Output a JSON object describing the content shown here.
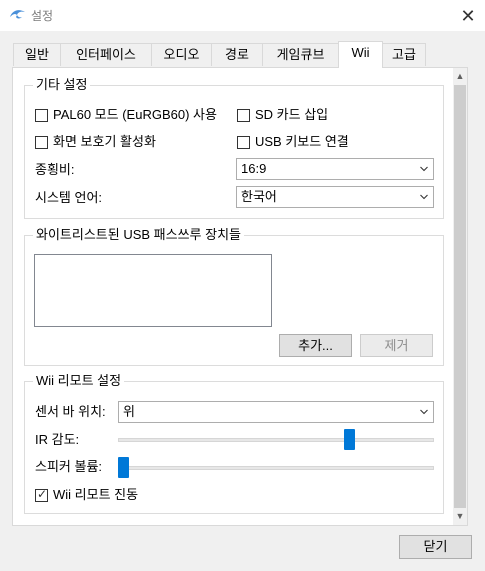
{
  "window": {
    "title": "설정",
    "app_icon": "dolphin-icon",
    "close_icon": "close-icon",
    "close_glyph": "✕"
  },
  "tabs": [
    {
      "label": "일반",
      "active": false
    },
    {
      "label": "인터페이스",
      "active": false
    },
    {
      "label": "오디오",
      "active": false
    },
    {
      "label": "경로",
      "active": false
    },
    {
      "label": "게임큐브",
      "active": false
    },
    {
      "label": "Wii",
      "active": true
    },
    {
      "label": "고급",
      "active": false
    }
  ],
  "misc_settings": {
    "title": "기타 설정",
    "pal60": {
      "label": "PAL60 모드 (EuRGB60) 사용",
      "checked": false
    },
    "sd_card": {
      "label": "SD 카드 삽입",
      "checked": false
    },
    "screensaver": {
      "label": "화면 보호기 활성화",
      "checked": false
    },
    "usb_keyboard": {
      "label": "USB 키보드 연결",
      "checked": false
    },
    "aspect_label": "종횡비:",
    "aspect_value": "16:9",
    "language_label": "시스템 언어:",
    "language_value": "한국어"
  },
  "usb_passthrough": {
    "title": "와이트리스트된 USB 패스쓰루 장치들",
    "add_label": "추가...",
    "remove_label": "제거"
  },
  "wiimote": {
    "title": "Wii 리모트 설정",
    "sensor_label": "센서 바 위치:",
    "sensor_value": "위",
    "ir_label": "IR 감도:",
    "ir_level": 0.74,
    "speaker_label": "스피커 볼륨:",
    "speaker_level": 0.0,
    "rumble": {
      "label": "Wii 리모트 진동",
      "checked": true
    }
  },
  "scroll": {
    "up_glyph": "▲",
    "down_glyph": "▼"
  },
  "close_button_label": "닫기",
  "colors": {
    "accent": "#0078d7"
  }
}
